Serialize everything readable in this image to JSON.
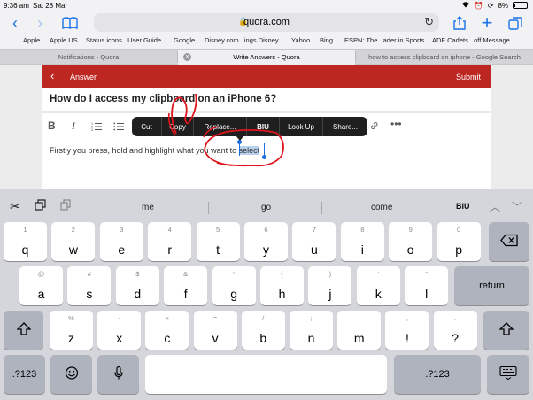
{
  "status_bar": {
    "time": "9:36 am",
    "date": "Sat 28 Mar",
    "battery": "8%",
    "battery_level": 0.08
  },
  "nav": {
    "url": "quora.com"
  },
  "bookmarks": [
    "Apple",
    "Apple US",
    "Status icons...User Guide",
    "Google",
    "Disney.com...ings Disney",
    "Yahoo",
    "Bing",
    "ESPN: The...ader in Sports",
    "ADF Cadets...off Message"
  ],
  "tabs": [
    {
      "label": "Notifications - Quora"
    },
    {
      "label": "Write Answers - Quora"
    },
    {
      "label": "how to access clipboard on iphone - Google Search"
    }
  ],
  "page": {
    "header_title": "Answer",
    "submit_label": "Submit",
    "question": "How do I access my clipboard on an iPhone 6?",
    "toolbar": {
      "bold": "B",
      "italic": "I"
    },
    "answer_text": "Firstly you press, hold and highlight what you want to ",
    "selected_text": "select"
  },
  "callout_menu": {
    "cut": "Cut",
    "copy": "Copy",
    "replace": "Replace...",
    "biu": "BIU",
    "lookup": "Look Up",
    "share": "Share..."
  },
  "keyboard": {
    "suggestions": [
      "me",
      "go",
      "come"
    ],
    "format_label": "BIU",
    "row1": [
      {
        "p": "q",
        "s": "1"
      },
      {
        "p": "w",
        "s": "2"
      },
      {
        "p": "e",
        "s": "3"
      },
      {
        "p": "r",
        "s": "4"
      },
      {
        "p": "t",
        "s": "5"
      },
      {
        "p": "y",
        "s": "6"
      },
      {
        "p": "u",
        "s": "7"
      },
      {
        "p": "i",
        "s": "8"
      },
      {
        "p": "o",
        "s": "9"
      },
      {
        "p": "p",
        "s": "0"
      }
    ],
    "row2": [
      {
        "p": "a",
        "s": "@"
      },
      {
        "p": "s",
        "s": "#"
      },
      {
        "p": "d",
        "s": "$"
      },
      {
        "p": "f",
        "s": "&"
      },
      {
        "p": "g",
        "s": "*"
      },
      {
        "p": "h",
        "s": "("
      },
      {
        "p": "j",
        "s": ")"
      },
      {
        "p": "k",
        "s": "'"
      },
      {
        "p": "l",
        "s": "\""
      }
    ],
    "return_label": "return",
    "row3": [
      {
        "p": "z",
        "s": "%"
      },
      {
        "p": "x",
        "s": "-"
      },
      {
        "p": "c",
        "s": "+"
      },
      {
        "p": "v",
        "s": "="
      },
      {
        "p": "b",
        "s": "/"
      },
      {
        "p": "n",
        "s": ";"
      },
      {
        "p": "m",
        "s": ":"
      },
      {
        "p": "!",
        "s": ","
      },
      {
        "p": "?",
        "s": "."
      }
    ],
    "numbers_label": ".?123"
  },
  "colors": {
    "quora_red": "#bd2722",
    "ios_blue": "#1a73e8",
    "annotation_red": "#e0141c",
    "selection": "#b9d1ee"
  }
}
